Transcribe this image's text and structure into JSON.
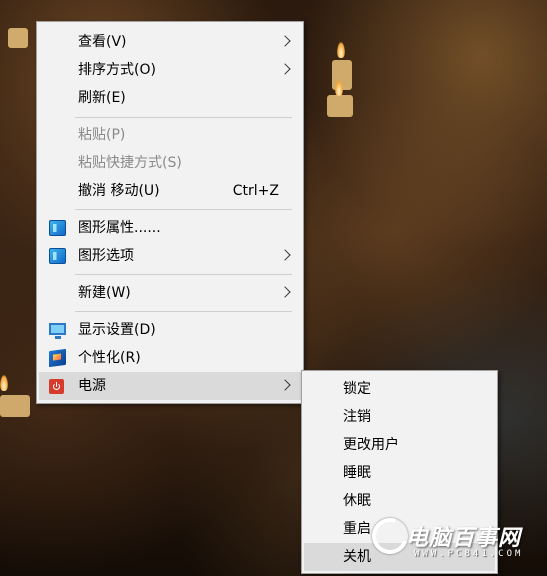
{
  "context_menu": {
    "items": [
      {
        "label": "查看(V)",
        "submenu": true,
        "disabled": false
      },
      {
        "label": "排序方式(O)",
        "submenu": true,
        "disabled": false
      },
      {
        "label": "刷新(E)",
        "submenu": false,
        "disabled": false
      },
      {
        "label": "粘贴(P)",
        "submenu": false,
        "disabled": true
      },
      {
        "label": "粘贴快捷方式(S)",
        "submenu": false,
        "disabled": true
      },
      {
        "label": "撤消 移动(U)",
        "accelerator": "Ctrl+Z",
        "submenu": false,
        "disabled": false
      },
      {
        "label": "图形属性......",
        "icon": "intel-graphics-icon",
        "submenu": false,
        "disabled": false
      },
      {
        "label": "图形选项",
        "icon": "intel-graphics-icon",
        "submenu": true,
        "disabled": false
      },
      {
        "label": "新建(W)",
        "submenu": true,
        "disabled": false
      },
      {
        "label": "显示设置(D)",
        "icon": "display-icon",
        "submenu": false,
        "disabled": false
      },
      {
        "label": "个性化(R)",
        "icon": "personalize-icon",
        "submenu": false,
        "disabled": false
      },
      {
        "label": "电源",
        "icon": "power-icon",
        "submenu": true,
        "disabled": false,
        "highlighted": true
      }
    ]
  },
  "power_submenu": {
    "items": [
      {
        "label": "锁定"
      },
      {
        "label": "注销"
      },
      {
        "label": "更改用户"
      },
      {
        "label": "睡眠"
      },
      {
        "label": "休眠"
      },
      {
        "label": "重启"
      },
      {
        "label": "关机",
        "highlighted": true
      }
    ]
  },
  "watermark": {
    "title": "电脑百事网",
    "url": "WWW.PC841.COM"
  },
  "colors": {
    "menu_background": "#f2f2f2",
    "highlight": "#dadada",
    "disabled_text": "#8a8a8a",
    "power_icon": "#d63b2b"
  }
}
